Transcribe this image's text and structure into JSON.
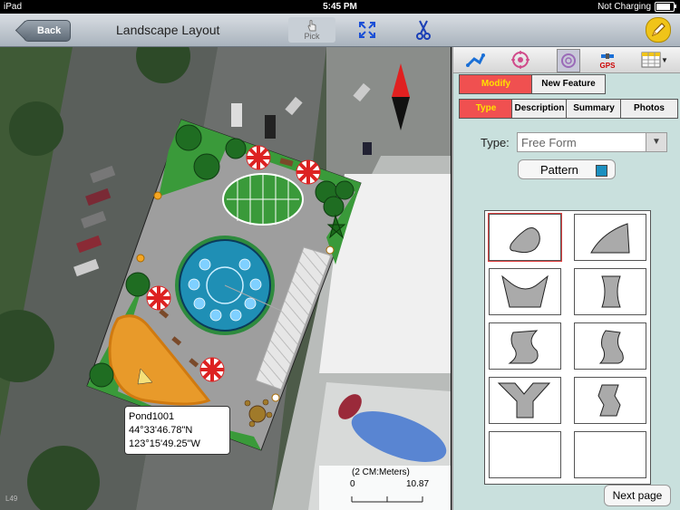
{
  "status_bar": {
    "device": "iPad",
    "time": "5:45 PM",
    "charging": "Not Charging"
  },
  "nav_bar": {
    "back_label": "Back",
    "title": "Landscape Layout",
    "pick_label": "Pick"
  },
  "map": {
    "callout": {
      "name": "Pond1001",
      "latitude": "44°33'46.78\"N",
      "longitude": "123°15'49.25\"W"
    },
    "scale": {
      "title": "(2 CM:Meters)",
      "min": "0",
      "max": "10.87"
    },
    "watermark": "L49"
  },
  "panel": {
    "toolbar": {
      "gps_label": "GPS"
    },
    "mode_tabs": [
      {
        "label": "Modify",
        "active": true
      },
      {
        "label": "New Feature",
        "active": false
      }
    ],
    "sub_tabs": [
      {
        "label": "Type",
        "active": true
      },
      {
        "label": "Description",
        "active": false
      },
      {
        "label": "Summary",
        "active": false
      },
      {
        "label": "Photos",
        "active": false
      }
    ],
    "type_label": "Type:",
    "type_value": "Free Form",
    "pattern_label": "Pattern",
    "pattern_color": "#1b8fbf",
    "next_page_label": "Next page"
  },
  "colors": {
    "accent_red": "#f05050",
    "accent_yellow": "#ffe200",
    "panel_bg": "#c9e0dd",
    "lawn": "#3a9a3a",
    "pond": "#e89a2a",
    "fountain": "#1f8fb5"
  }
}
